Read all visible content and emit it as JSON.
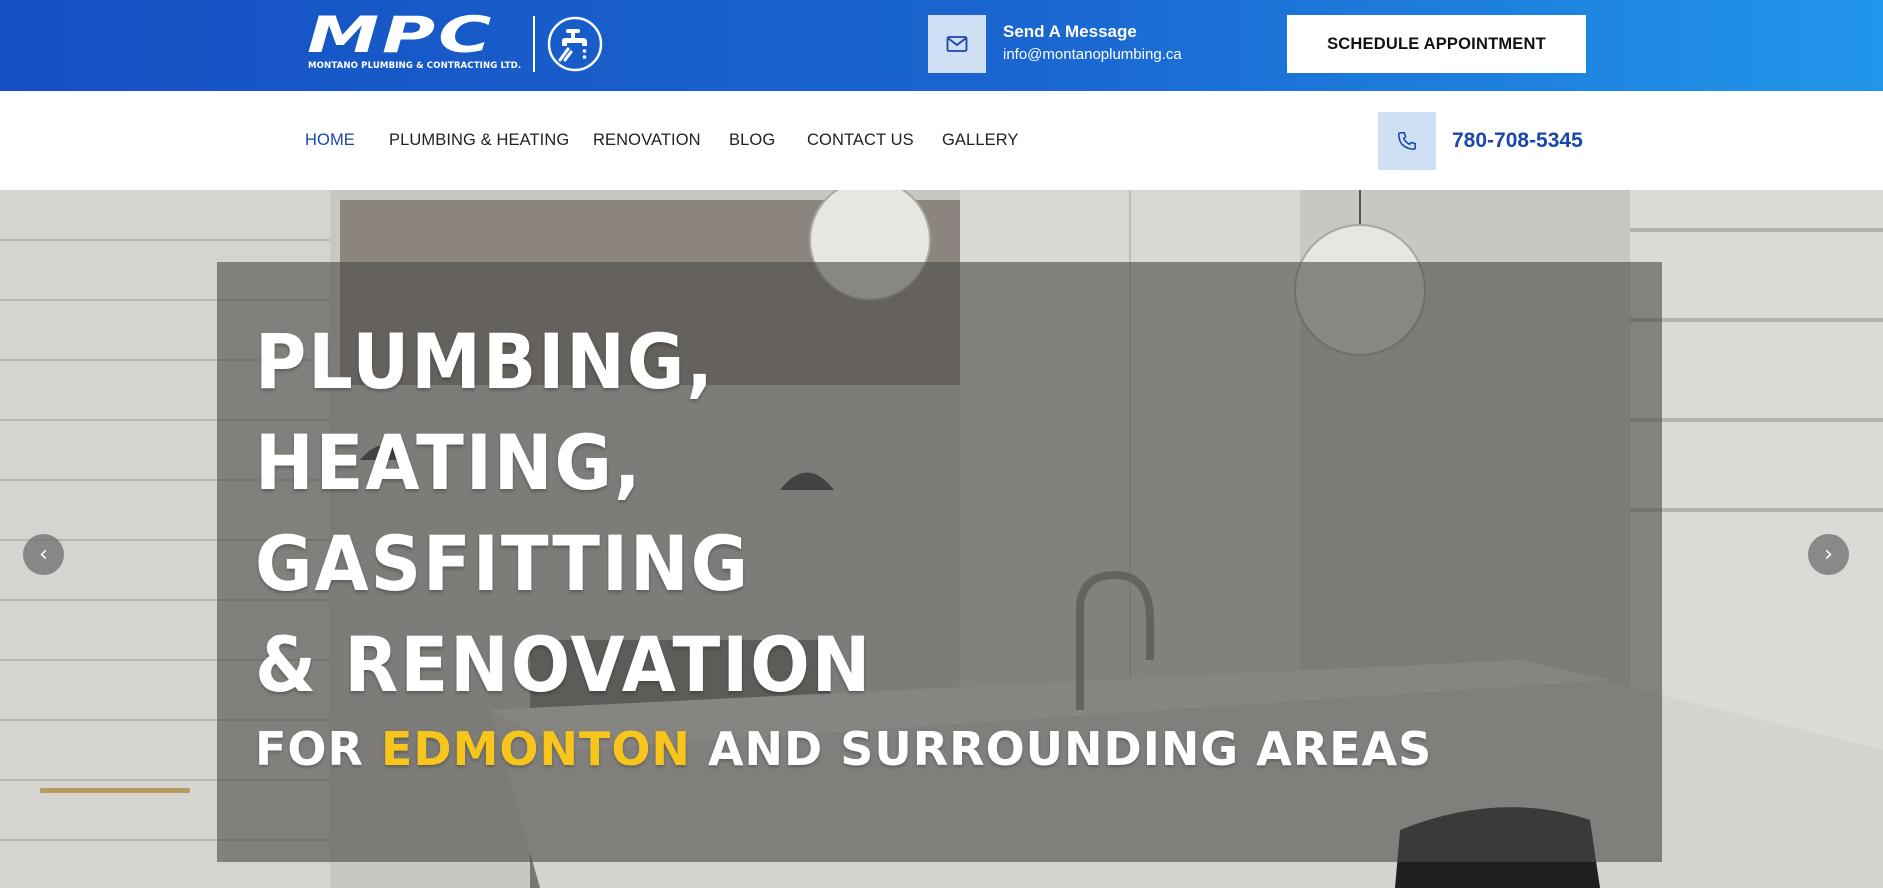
{
  "header": {
    "logo": {
      "wordmark": "MPC",
      "company": "MONTANO PLUMBING & CONTRACTING LTD."
    },
    "message": {
      "title": "Send A Message",
      "email": "info@montanoplumbing.ca",
      "icon": "envelope-icon"
    },
    "schedule_button": "SCHEDULE APPOINTMENT"
  },
  "nav": {
    "items": [
      {
        "label": "HOME",
        "active": true
      },
      {
        "label": "PLUMBING & HEATING",
        "active": false
      },
      {
        "label": "RENOVATION",
        "active": false
      },
      {
        "label": "BLOG",
        "active": false
      },
      {
        "label": "CONTACT US",
        "active": false
      },
      {
        "label": "GALLERY",
        "active": false
      }
    ],
    "phone": {
      "number": "780-708-5345",
      "icon": "phone-icon"
    }
  },
  "hero": {
    "lines": [
      "PLUMBING,",
      "HEATING,",
      "GASFITTING",
      "& RENOVATION"
    ],
    "sub_before": "FOR ",
    "sub_accent": "EDMONTON",
    "sub_after": " AND SURROUNDING AREAS",
    "prev_arrow": "‹",
    "next_arrow": "›"
  },
  "colors": {
    "topbar_start": "#1550c2",
    "topbar_end": "#2196ea",
    "nav_active": "#1a47a8",
    "accent_yellow": "#f7c51c",
    "icon_box": "#cfe0f5"
  }
}
